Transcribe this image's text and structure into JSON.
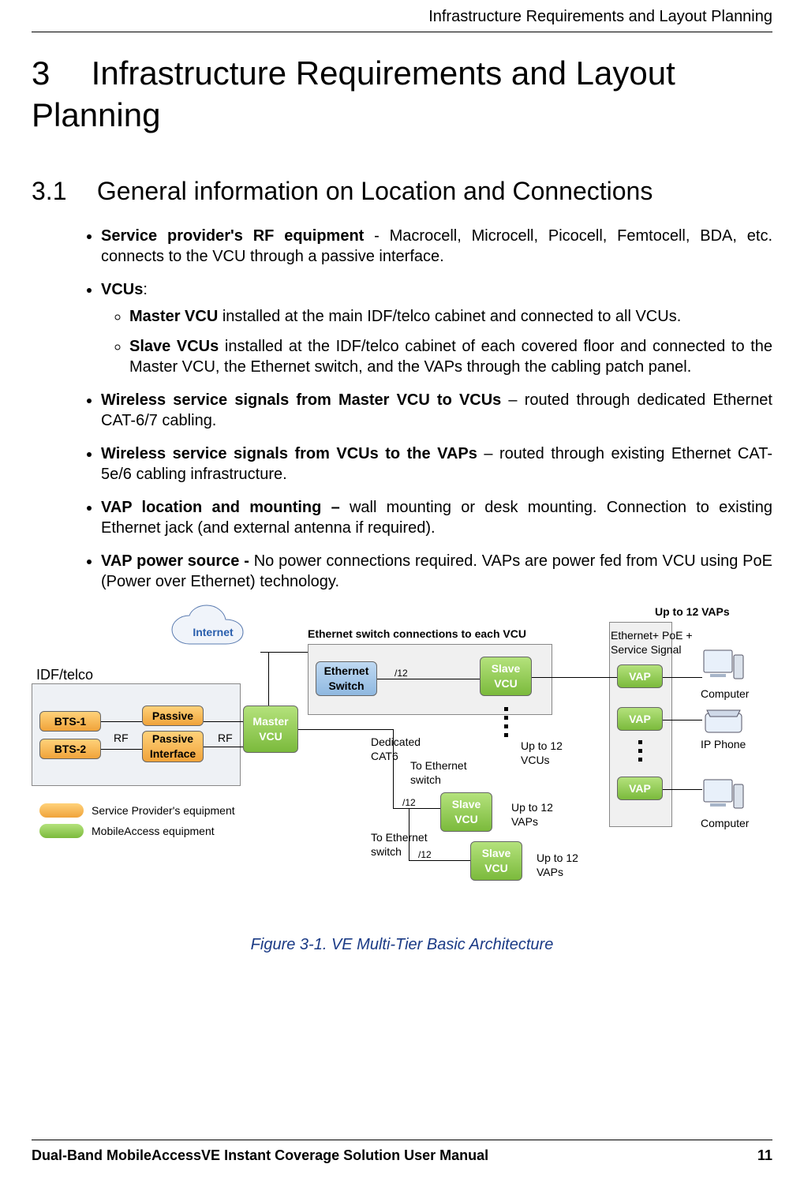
{
  "header": {
    "title": "Infrastructure Requirements and Layout Planning"
  },
  "chapter": {
    "number": "3",
    "title": "Infrastructure Requirements and Layout Planning"
  },
  "section": {
    "number": "3.1",
    "title": "General information on Location and Connections"
  },
  "bullets": [
    {
      "b": "Service provider's RF equipment",
      "t": " - Macrocell, Microcell, Picocell, Femtocell, BDA, etc. connects to the VCU through a passive interface."
    },
    {
      "b": "VCUs",
      "t": ":",
      "sub": [
        {
          "b": "Master VCU",
          "t": " installed at the main IDF/telco cabinet and connected to all VCUs."
        },
        {
          "b": "Slave VCUs",
          "t": " installed at the IDF/telco cabinet of each covered floor and connected to the Master VCU, the Ethernet switch, and the VAPs through the cabling patch panel."
        }
      ]
    },
    {
      "b": "Wireless service signals from Master VCU to VCUs",
      "t": " – routed through dedicated Ethernet CAT-6/7 cabling."
    },
    {
      "b": "Wireless service signals from VCUs to the VAPs",
      "t": " – routed through existing Ethernet CAT-5e/6 cabling infrastructure."
    },
    {
      "b": "VAP location and mounting – ",
      "t": "wall mounting or desk mounting. Connection to existing Ethernet jack (and external antenna if required)."
    },
    {
      "b": "VAP power source - ",
      "t": "No power connections required. VAPs are power fed from VCU using PoE (Power over Ethernet) technology."
    }
  ],
  "figure": {
    "caption": "Figure 3-1. VE Multi-Tier Basic Architecture",
    "labels": {
      "internet": "Internet",
      "idf": "IDF/telco",
      "bts1": "BTS-1",
      "bts2": "BTS-2",
      "passive1": "Passive",
      "passive2": "Passive Interface",
      "rf": "RF",
      "master_vcu": "Master VCU",
      "eth_switch": "Ethernet Switch",
      "eth_switch_conn": "Ethernet switch connections to each VCU",
      "dedicated": "Dedicated CAT6",
      "to_eth_switch": "To Ethernet switch",
      "slave_vcu": "Slave VCU",
      "up12_vcus": "Up to 12 VCUs",
      "up12_vaps": "Up to 12 VAPs",
      "up12_vaps_hdr": "Up to 12 VAPs",
      "vap": "VAP",
      "eth_poe": "Ethernet+ PoE + Service Signal",
      "computer": "Computer",
      "ip_phone": "IP Phone",
      "slash12": "/12",
      "legend_sp": "Service Provider's equipment",
      "legend_ma": "MobileAccess equipment"
    }
  },
  "footer": {
    "manual": "Dual-Band MobileAccessVE Instant Coverage Solution User Manual",
    "page": "11"
  }
}
